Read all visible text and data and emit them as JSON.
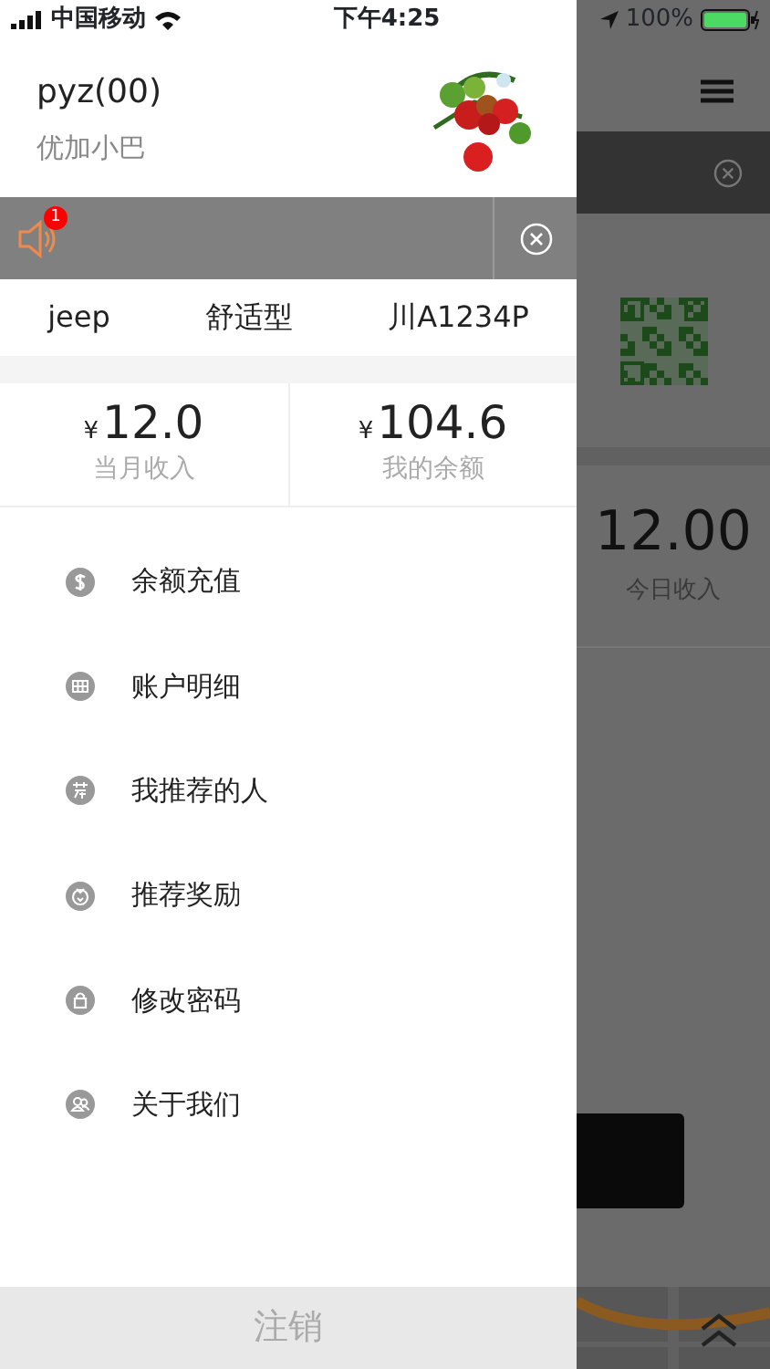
{
  "status_bar": {
    "carrier": "中国移动",
    "time": "下午4:25",
    "battery": "100%"
  },
  "profile": {
    "name": "pyz(00)",
    "subtitle": "优加小巴"
  },
  "notice": {
    "badge": "1"
  },
  "vehicle": [
    "jeep",
    "舒适型",
    "川A1234P"
  ],
  "stats": [
    {
      "currency": "¥",
      "amount": "12.0",
      "label": "当月收入"
    },
    {
      "currency": "¥",
      "amount": "104.6",
      "label": "我的余额"
    }
  ],
  "menu": [
    {
      "kind": "dollar",
      "label": "余额充值"
    },
    {
      "kind": "grid",
      "label": "账户明细"
    },
    {
      "kind": "referral",
      "label": "我推荐的人"
    },
    {
      "kind": "reward",
      "label": "推荐奖励"
    },
    {
      "kind": "lock",
      "label": "修改密码"
    },
    {
      "kind": "people",
      "label": "关于我们"
    }
  ],
  "logout": "注销",
  "background": {
    "amount": "12.00",
    "label": "今日收入"
  }
}
